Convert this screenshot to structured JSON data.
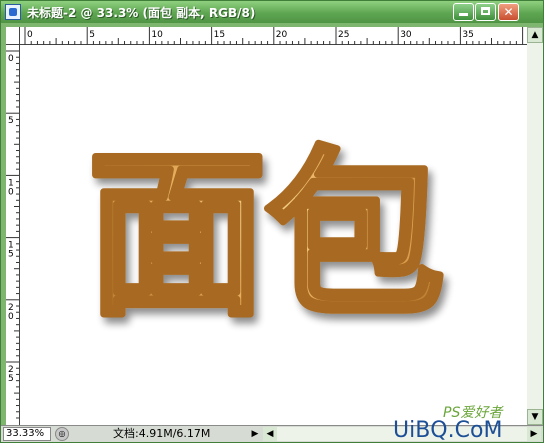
{
  "window": {
    "title": "未标题-2 @ 33.3% (面包 副本, RGB/8)",
    "minimize_glyph": "",
    "maximize_glyph": "",
    "close_glyph": "✕"
  },
  "ruler": {
    "horizontal_labels": [
      "0",
      "5",
      "10",
      "15",
      "20",
      "25",
      "30",
      "35"
    ],
    "vertical_labels": [
      "0",
      "5",
      "10",
      "15",
      "20",
      "25"
    ]
  },
  "canvas": {
    "artwork_text": "面包",
    "artwork_fill": "#e0a64f",
    "artwork_stroke": "#a86a22"
  },
  "status": {
    "zoom": "33.33%",
    "doc_info": "文档:4.91M/6.17M",
    "arrow": "▶"
  },
  "scrollbar": {
    "up": "▲",
    "down": "▼",
    "left": "◀",
    "right": "▶"
  },
  "watermark": {
    "text": "UiBQ.CoM",
    "ps_text": "PS爱好者"
  },
  "colors": {
    "frame_green": "#7fb66f",
    "title_gradient_top": "#8fd07f",
    "title_gradient_bottom": "#4f9444"
  }
}
